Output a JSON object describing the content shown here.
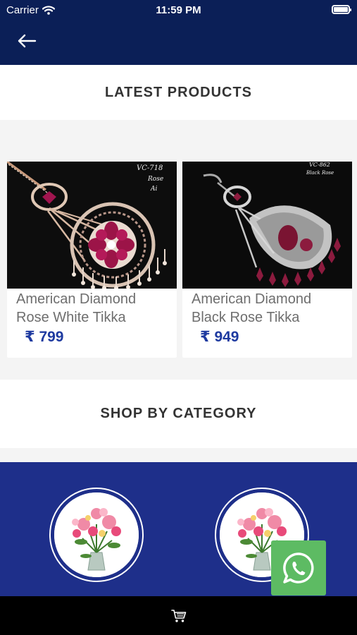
{
  "status_bar": {
    "carrier": "Carrier",
    "time": "11:59 PM"
  },
  "icons": {
    "back": "arrow-left",
    "wifi": "wifi",
    "battery": "battery-full",
    "whatsapp": "whatsapp-logo",
    "cart": "shopping-cart"
  },
  "sections": {
    "latest_products": "LATEST PRODUCTS",
    "shop_by_category": "SHOP BY CATEGORY"
  },
  "products": [
    {
      "name": "American Diamond Rose White Tikka",
      "price": "₹ 799",
      "tag_code": "VC-718",
      "tag_sub": "Rose",
      "tag_sub2": "Ai"
    },
    {
      "name": "American Diamond Black Rose Tikka",
      "price": "₹ 949",
      "tag_code": "VC-862",
      "tag_sub": "Black Rose"
    }
  ],
  "categories": [
    {
      "image": "flower-bouquet"
    },
    {
      "image": "flower-bouquet"
    }
  ],
  "colors": {
    "header": "#0b1f57",
    "category_panel": "#1e2f8a",
    "price": "#1e3aa0",
    "whatsapp": "#5dbb63"
  }
}
